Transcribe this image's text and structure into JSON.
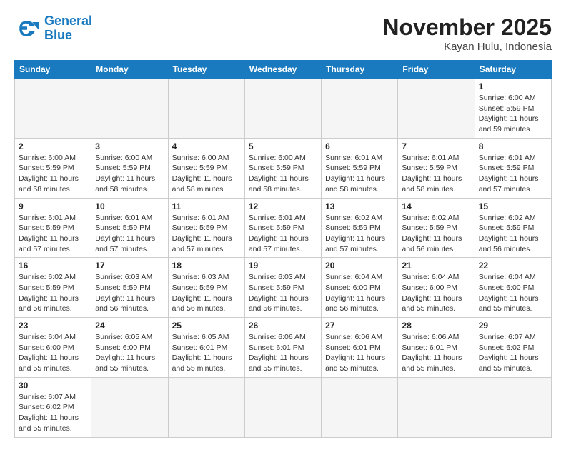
{
  "header": {
    "logo_general": "General",
    "logo_blue": "Blue",
    "month_title": "November 2025",
    "location": "Kayan Hulu, Indonesia"
  },
  "weekdays": [
    "Sunday",
    "Monday",
    "Tuesday",
    "Wednesday",
    "Thursday",
    "Friday",
    "Saturday"
  ],
  "weeks": [
    [
      {
        "day": "",
        "info": ""
      },
      {
        "day": "",
        "info": ""
      },
      {
        "day": "",
        "info": ""
      },
      {
        "day": "",
        "info": ""
      },
      {
        "day": "",
        "info": ""
      },
      {
        "day": "",
        "info": ""
      },
      {
        "day": "1",
        "info": "Sunrise: 6:00 AM\nSunset: 5:59 PM\nDaylight: 11 hours\nand 59 minutes."
      }
    ],
    [
      {
        "day": "2",
        "info": "Sunrise: 6:00 AM\nSunset: 5:59 PM\nDaylight: 11 hours\nand 58 minutes."
      },
      {
        "day": "3",
        "info": "Sunrise: 6:00 AM\nSunset: 5:59 PM\nDaylight: 11 hours\nand 58 minutes."
      },
      {
        "day": "4",
        "info": "Sunrise: 6:00 AM\nSunset: 5:59 PM\nDaylight: 11 hours\nand 58 minutes."
      },
      {
        "day": "5",
        "info": "Sunrise: 6:00 AM\nSunset: 5:59 PM\nDaylight: 11 hours\nand 58 minutes."
      },
      {
        "day": "6",
        "info": "Sunrise: 6:01 AM\nSunset: 5:59 PM\nDaylight: 11 hours\nand 58 minutes."
      },
      {
        "day": "7",
        "info": "Sunrise: 6:01 AM\nSunset: 5:59 PM\nDaylight: 11 hours\nand 58 minutes."
      },
      {
        "day": "8",
        "info": "Sunrise: 6:01 AM\nSunset: 5:59 PM\nDaylight: 11 hours\nand 57 minutes."
      }
    ],
    [
      {
        "day": "9",
        "info": "Sunrise: 6:01 AM\nSunset: 5:59 PM\nDaylight: 11 hours\nand 57 minutes."
      },
      {
        "day": "10",
        "info": "Sunrise: 6:01 AM\nSunset: 5:59 PM\nDaylight: 11 hours\nand 57 minutes."
      },
      {
        "day": "11",
        "info": "Sunrise: 6:01 AM\nSunset: 5:59 PM\nDaylight: 11 hours\nand 57 minutes."
      },
      {
        "day": "12",
        "info": "Sunrise: 6:01 AM\nSunset: 5:59 PM\nDaylight: 11 hours\nand 57 minutes."
      },
      {
        "day": "13",
        "info": "Sunrise: 6:02 AM\nSunset: 5:59 PM\nDaylight: 11 hours\nand 57 minutes."
      },
      {
        "day": "14",
        "info": "Sunrise: 6:02 AM\nSunset: 5:59 PM\nDaylight: 11 hours\nand 56 minutes."
      },
      {
        "day": "15",
        "info": "Sunrise: 6:02 AM\nSunset: 5:59 PM\nDaylight: 11 hours\nand 56 minutes."
      }
    ],
    [
      {
        "day": "16",
        "info": "Sunrise: 6:02 AM\nSunset: 5:59 PM\nDaylight: 11 hours\nand 56 minutes."
      },
      {
        "day": "17",
        "info": "Sunrise: 6:03 AM\nSunset: 5:59 PM\nDaylight: 11 hours\nand 56 minutes."
      },
      {
        "day": "18",
        "info": "Sunrise: 6:03 AM\nSunset: 5:59 PM\nDaylight: 11 hours\nand 56 minutes."
      },
      {
        "day": "19",
        "info": "Sunrise: 6:03 AM\nSunset: 5:59 PM\nDaylight: 11 hours\nand 56 minutes."
      },
      {
        "day": "20",
        "info": "Sunrise: 6:04 AM\nSunset: 6:00 PM\nDaylight: 11 hours\nand 56 minutes."
      },
      {
        "day": "21",
        "info": "Sunrise: 6:04 AM\nSunset: 6:00 PM\nDaylight: 11 hours\nand 55 minutes."
      },
      {
        "day": "22",
        "info": "Sunrise: 6:04 AM\nSunset: 6:00 PM\nDaylight: 11 hours\nand 55 minutes."
      }
    ],
    [
      {
        "day": "23",
        "info": "Sunrise: 6:04 AM\nSunset: 6:00 PM\nDaylight: 11 hours\nand 55 minutes."
      },
      {
        "day": "24",
        "info": "Sunrise: 6:05 AM\nSunset: 6:00 PM\nDaylight: 11 hours\nand 55 minutes."
      },
      {
        "day": "25",
        "info": "Sunrise: 6:05 AM\nSunset: 6:01 PM\nDaylight: 11 hours\nand 55 minutes."
      },
      {
        "day": "26",
        "info": "Sunrise: 6:06 AM\nSunset: 6:01 PM\nDaylight: 11 hours\nand 55 minutes."
      },
      {
        "day": "27",
        "info": "Sunrise: 6:06 AM\nSunset: 6:01 PM\nDaylight: 11 hours\nand 55 minutes."
      },
      {
        "day": "28",
        "info": "Sunrise: 6:06 AM\nSunset: 6:01 PM\nDaylight: 11 hours\nand 55 minutes."
      },
      {
        "day": "29",
        "info": "Sunrise: 6:07 AM\nSunset: 6:02 PM\nDaylight: 11 hours\nand 55 minutes."
      }
    ],
    [
      {
        "day": "30",
        "info": "Sunrise: 6:07 AM\nSunset: 6:02 PM\nDaylight: 11 hours\nand 55 minutes."
      },
      {
        "day": "",
        "info": ""
      },
      {
        "day": "",
        "info": ""
      },
      {
        "day": "",
        "info": ""
      },
      {
        "day": "",
        "info": ""
      },
      {
        "day": "",
        "info": ""
      },
      {
        "day": "",
        "info": ""
      }
    ]
  ]
}
